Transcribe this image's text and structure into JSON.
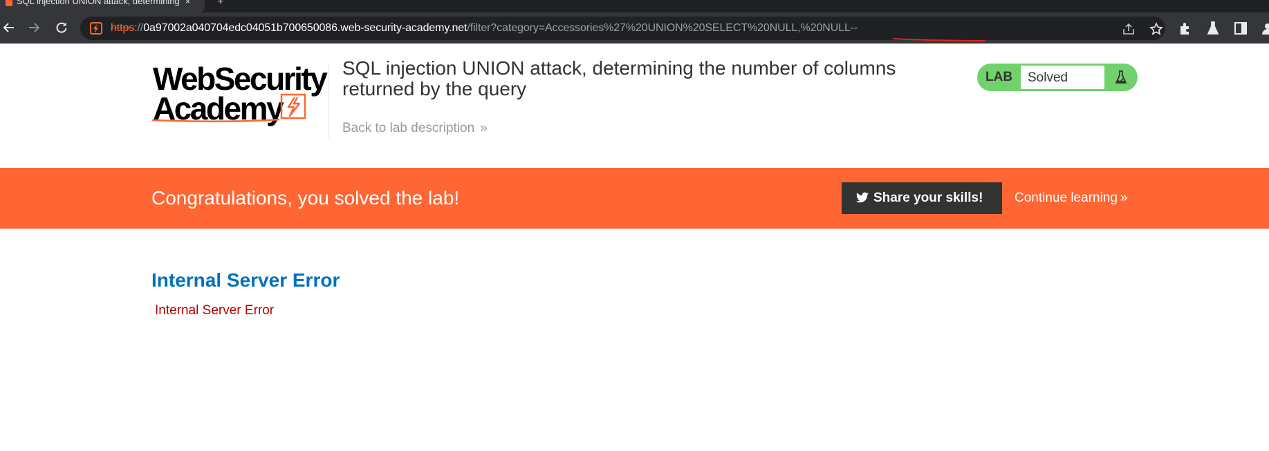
{
  "browser": {
    "tab_title": "SQL injection UNION attack, determining the",
    "tab_close": "×",
    "new_tab": "+",
    "url_scheme": "https",
    "url_separator": "://",
    "url_host": "0a97002a040704edc04051b700650086.web-security-academy.net",
    "url_path": "/filter?category=Accessories%27%20UNION%20SELECT%20NULL,%20NULL--",
    "annotation_color": "#e0261b"
  },
  "header": {
    "logo_line1": "WebSecurity",
    "logo_line2": "Academy",
    "lab_title": "SQL injection UNION attack, determining the number of columns returned by the query",
    "back_link": "Back to lab description",
    "back_chevron": "»",
    "lab_badge": "LAB",
    "lab_status": "Solved",
    "status_color": "#70d16d"
  },
  "banner": {
    "message": "Congratulations, you solved the lab!",
    "share_label": "Share your skills!",
    "continue_label": "Continue learning",
    "continue_chevron": "»",
    "color": "#ff6633"
  },
  "content": {
    "heading": "Internal Server Error",
    "body": "Internal Server Error"
  }
}
